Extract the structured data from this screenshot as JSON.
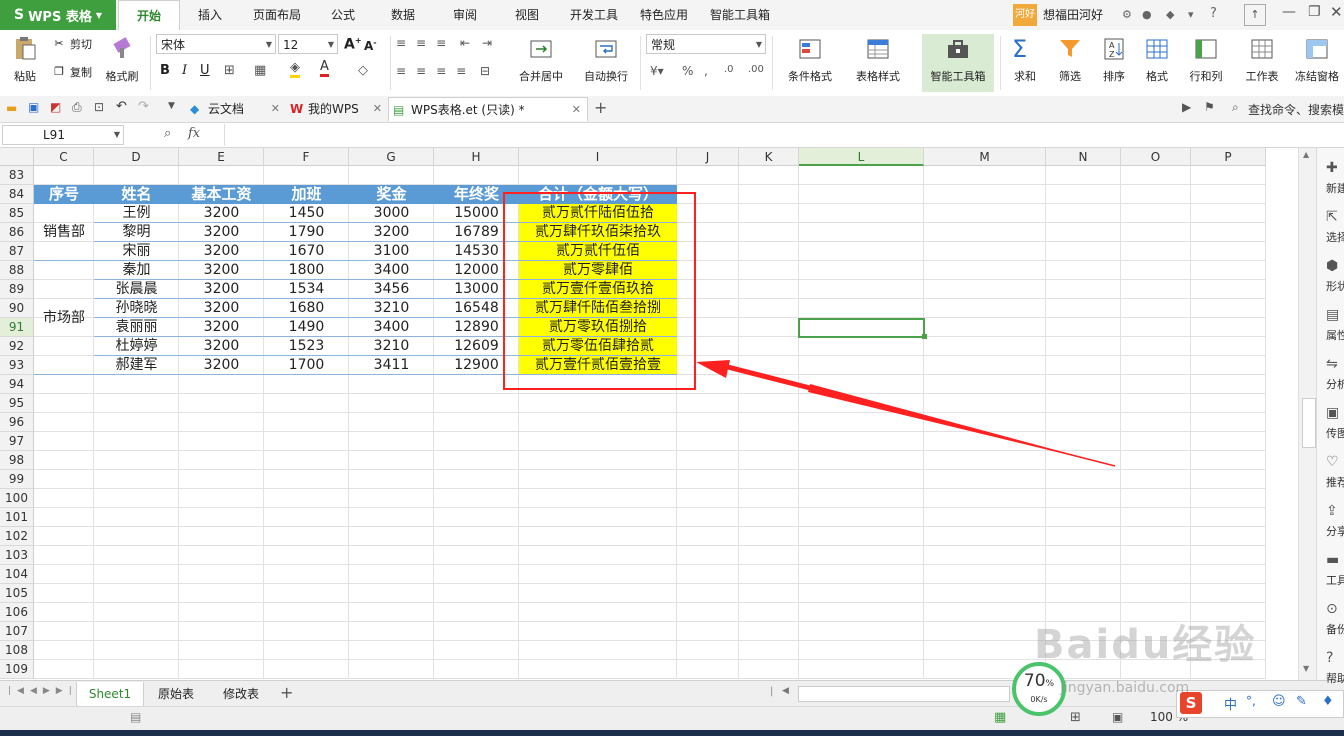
{
  "app": {
    "name": "WPS 表格",
    "user": "想福田河好",
    "user_badge": "河好"
  },
  "menu": [
    "开始",
    "插入",
    "页面布局",
    "公式",
    "数据",
    "审阅",
    "视图",
    "开发工具",
    "特色应用",
    "智能工具箱"
  ],
  "ribbon": {
    "paste": "粘贴",
    "cut": "剪切",
    "copy": "复制",
    "format_painter": "格式刷",
    "font_name": "宋体",
    "font_size": "12",
    "merge_center": "合并居中",
    "wrap_text": "自动换行",
    "number_format": "常规",
    "conditional_format": "条件格式",
    "table_style": "表格样式",
    "smart_toolbox": "智能工具箱",
    "sum": "求和",
    "filter": "筛选",
    "sort": "排序",
    "format": "格式",
    "rows_cols": "行和列",
    "worksheet": "工作表",
    "freeze": "冻结窗格"
  },
  "tabs": [
    {
      "label": "云文档"
    },
    {
      "label": "我的WPS"
    },
    {
      "label": "WPS表格.et (只读) *"
    }
  ],
  "search_placeholder": "查找命令、搜索模",
  "formula": {
    "namebox": "L91",
    "fx": "fx",
    "content": ""
  },
  "columns": [
    "C",
    "D",
    "E",
    "F",
    "G",
    "H",
    "I",
    "J",
    "K",
    "L",
    "M",
    "N",
    "O",
    "P"
  ],
  "rows": [
    "83",
    "84",
    "85",
    "86",
    "87",
    "88",
    "89",
    "90",
    "91",
    "92",
    "93",
    "94",
    "95",
    "96",
    "97",
    "98",
    "99",
    "100",
    "101",
    "102",
    "103",
    "104",
    "105",
    "106",
    "107",
    "108",
    "109"
  ],
  "selected_cell": "L91",
  "table": {
    "headers": [
      "序号",
      "姓名",
      "基本工资",
      "加班",
      "奖金",
      "年终奖",
      "合计（金额大写）"
    ],
    "groups": [
      "销售部",
      "市场部"
    ],
    "records": [
      [
        "王例",
        "3200",
        "1450",
        "3000",
        "15000",
        "贰万贰仟陆佰伍拾"
      ],
      [
        "黎明",
        "3200",
        "1790",
        "3200",
        "16789",
        "贰万肆仟玖佰柒拾玖"
      ],
      [
        "宋丽",
        "3200",
        "1670",
        "3100",
        "14530",
        "贰万贰仟伍佰"
      ],
      [
        "秦加",
        "3200",
        "1800",
        "3400",
        "12000",
        "贰万零肆佰"
      ],
      [
        "张晨晨",
        "3200",
        "1534",
        "3456",
        "13000",
        "贰万壹仟壹佰玖拾"
      ],
      [
        "孙晓晓",
        "3200",
        "1680",
        "3210",
        "16548",
        "贰万肆仟陆佰叁拾捌"
      ],
      [
        "袁丽丽",
        "3200",
        "1490",
        "3400",
        "12890",
        "贰万零玖佰捌拾"
      ],
      [
        "杜婷婷",
        "3200",
        "1523",
        "3210",
        "12609",
        "贰万零伍佰肆拾贰"
      ],
      [
        "郝建军",
        "3200",
        "1700",
        "3411",
        "12900",
        "贰万壹仟贰佰壹拾壹"
      ]
    ]
  },
  "sheets": [
    "Sheet1",
    "原始表",
    "修改表"
  ],
  "right_panel": [
    "新建",
    "选择",
    "形状",
    "属性",
    "分析",
    "传图",
    "推荐",
    "分享",
    "工具",
    "备份",
    "帮助"
  ],
  "status": {
    "zoom": "100 %",
    "net_percent": "70",
    "net_speed": "0K/s"
  },
  "watermark": "Baidu经验",
  "watermark_url": "jingyan.baidu.com",
  "colors": {
    "accent": "#3f9f3f",
    "header_fill": "#5b9bd5",
    "highlight": "#ffff00",
    "annotation": "#ff2020"
  }
}
